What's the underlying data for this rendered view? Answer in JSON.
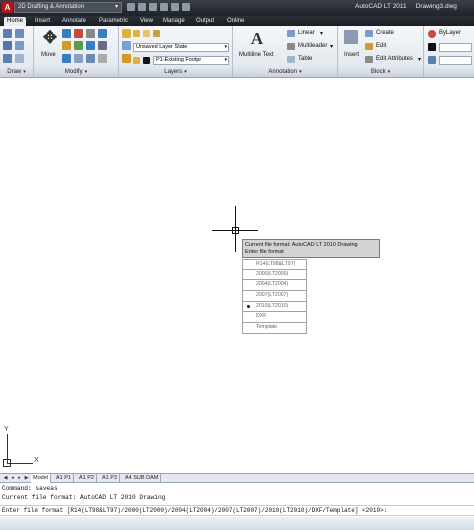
{
  "titlebar": {
    "app_icon": "A",
    "workspace": "2D Drafting & Annotation",
    "app_title": "AutoCAD LT 2011",
    "doc_title": "Drawing3.dwg"
  },
  "tabs": [
    "Home",
    "Insert",
    "Annotate",
    "Parametric",
    "View",
    "Manage",
    "Output",
    "Online"
  ],
  "ribbon": {
    "modify": {
      "move_label": "Move"
    },
    "layers": {
      "unsaved_state": "Unsaved Layer State",
      "current_layer": "P1-Existing Footpr"
    },
    "annotation": {
      "multiline_text": "Multiline Text",
      "linear": "Linear",
      "multileader": "Multileader",
      "table": "Table"
    },
    "block": {
      "insert": "Insert",
      "create": "Create",
      "edit": "Edit",
      "edit_attributes": "Edit Attributes"
    },
    "properties": {
      "bylayer": "ByLayer"
    },
    "panel_titles": {
      "draw": "Draw",
      "modify": "Modify",
      "layers": "Layers",
      "annotation": "Annotation",
      "block": "Block"
    }
  },
  "tooltip": {
    "line1": "Current file format: AutoCAD LT 2010 Drawing",
    "line2": "Enter file format"
  },
  "file_formats": [
    {
      "label": "R14(LT98&LT97)",
      "selected": false
    },
    {
      "label": "2000(LT2000)",
      "selected": false
    },
    {
      "label": "2004(LT2004)",
      "selected": false
    },
    {
      "label": "2007(LT2007)",
      "selected": false
    },
    {
      "label": "2010(LT2010)",
      "selected": true
    },
    {
      "label": "DXF",
      "selected": false
    },
    {
      "label": "Template",
      "selected": false
    }
  ],
  "ucs": {
    "y": "Y",
    "x": "X"
  },
  "layout_tabs": [
    "Model",
    "A1 P1",
    "A1 P2",
    "A1 P3",
    "A4 SUB DAM"
  ],
  "command": {
    "history1": "Command: saveas",
    "history2": "Current file format: AutoCAD LT 2010 Drawing",
    "prompt": "Enter file format [R14(LT98&LT97)/2000(LT2000)/2004(LT2004)/2007(LT2007)/2010(LT2010)/DXF/Template] <2010>:"
  },
  "colors": {
    "titlebar": "#2b2f36",
    "ribbon": "#e6ebf1",
    "accent_red": "#b8141a"
  }
}
